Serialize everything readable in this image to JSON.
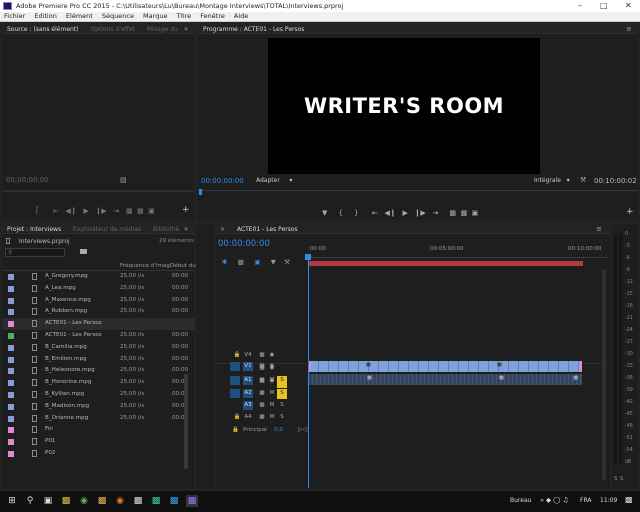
{
  "window": {
    "title": "Adobe Premiere Pro CC 2015 - C:\\Utilisateurs\\Lu\\Bureau\\Montage Interviews\\TOTAL\\Interviews.prproj",
    "app_icon": "premiere-pro-icon",
    "controls": [
      "minimize-icon",
      "maximize-icon",
      "close-icon"
    ]
  },
  "menu": [
    "Fichier",
    "Edition",
    "Elément",
    "Séquence",
    "Marque",
    "Titre",
    "Fenêtre",
    "Aide"
  ],
  "source_panel": {
    "tabs": [
      "Source : (sans élément)",
      "Options d'effet",
      "Mixage du"
    ],
    "timecode": "00;00;00;00",
    "buttons": [
      "mark-in",
      "mark-out",
      "go-to-in",
      "step-back",
      "play",
      "step-forward",
      "go-to-out",
      "insert",
      "overwrite",
      "export-frame"
    ]
  },
  "program_panel": {
    "tab": "Programme : ACTE01 - Les Persos",
    "viewer_text": "WRITER'S ROOM",
    "timecode": "00:00:00:00",
    "fit": "Adapter",
    "quality": "Intégrale",
    "duration": "00:10:00:02"
  },
  "project_panel": {
    "tabs": [
      "Projet : Interviews",
      "Explorateur de médias",
      "Bibliothè"
    ],
    "project_file": "Interviews.prproj",
    "item_count": "29 éléments",
    "columns": [
      "Nom",
      "Fréquence d'imag",
      "Début du"
    ],
    "items": [
      {
        "name": "A_Gregory.mpg",
        "fps": "25,00 i/s",
        "start": "00:00",
        "color": "#8a9bd6",
        "icon": "video-clip-icon"
      },
      {
        "name": "A_Lea.mpg",
        "fps": "25,00 i/s",
        "start": "00:00",
        "color": "#8a9bd6",
        "icon": "video-clip-icon"
      },
      {
        "name": "A_Maxence.mpg",
        "fps": "25,00 i/s",
        "start": "00:00",
        "color": "#8a9bd6",
        "icon": "video-clip-icon"
      },
      {
        "name": "A_Rubben.mpg",
        "fps": "25,00 i/s",
        "start": "00:00",
        "color": "#8a9bd6",
        "icon": "video-clip-icon"
      },
      {
        "name": "ACTE01 - Les Persos",
        "fps": "",
        "start": "",
        "color": "#e08ad6",
        "icon": "bin-icon"
      },
      {
        "name": "ACTE01 - Les Persos",
        "fps": "25,00 i/s",
        "start": "00:00",
        "color": "#4fae5c",
        "icon": "sequence-icon"
      },
      {
        "name": "B_Camilia.mpg",
        "fps": "25,00 i/s",
        "start": "00:00",
        "color": "#8a9bd6",
        "icon": "video-clip-icon"
      },
      {
        "name": "B_Emilien.mpg",
        "fps": "25,00 i/s",
        "start": "00:00",
        "color": "#8a9bd6",
        "icon": "video-clip-icon"
      },
      {
        "name": "B_Heleonore.mpg",
        "fps": "25,00 i/s",
        "start": "00:00",
        "color": "#8a9bd6",
        "icon": "video-clip-icon"
      },
      {
        "name": "B_Honorine.mpg",
        "fps": "25,00 i/s",
        "start": "00:00",
        "color": "#8a9bd6",
        "icon": "video-clip-icon"
      },
      {
        "name": "B_Kyllian.mpg",
        "fps": "25,00 i/s",
        "start": "00:00",
        "color": "#8a9bd6",
        "icon": "video-clip-icon"
      },
      {
        "name": "B_Madison.mpg",
        "fps": "25,00 i/s",
        "start": "00:00",
        "color": "#8a9bd6",
        "icon": "video-clip-icon"
      },
      {
        "name": "B_Orianne.mpg",
        "fps": "25,00 i/s",
        "start": "00:00",
        "color": "#8a9bd6",
        "icon": "video-clip-icon"
      },
      {
        "name": "Fin",
        "fps": "",
        "start": "",
        "color": "#e08ad6",
        "icon": "still-icon"
      },
      {
        "name": "P01",
        "fps": "",
        "start": "",
        "color": "#e08ad6",
        "icon": "still-icon"
      },
      {
        "name": "P02",
        "fps": "",
        "start": "",
        "color": "#e08ad6",
        "icon": "still-icon"
      }
    ]
  },
  "timeline": {
    "tab": "ACTE01 - Les Persos",
    "timecode": "00:00:00:00",
    "ruler": [
      ":00:00",
      "00:05:00:00",
      "00:10:00:00"
    ],
    "tracks": [
      "V4",
      "V3",
      "V2",
      "V1",
      "A1",
      "A2",
      "A3",
      "A4"
    ],
    "audio_buttons": {
      "mute": "M",
      "solo": "S"
    },
    "principal_label": "Principal",
    "principal_value": "0,0"
  },
  "audio_meter": {
    "scale": [
      "0",
      "-3",
      "-6",
      "-9",
      "-12",
      "-15",
      "-18",
      "-21",
      "-24",
      "-27",
      "-30",
      "-33",
      "-36",
      "-39",
      "-42",
      "-45",
      "-48",
      "-51",
      "-54",
      "dB"
    ],
    "footer": [
      "S",
      "S"
    ]
  },
  "taskbar": {
    "location": "Bureau",
    "language": "FRA",
    "time": "11:09"
  }
}
